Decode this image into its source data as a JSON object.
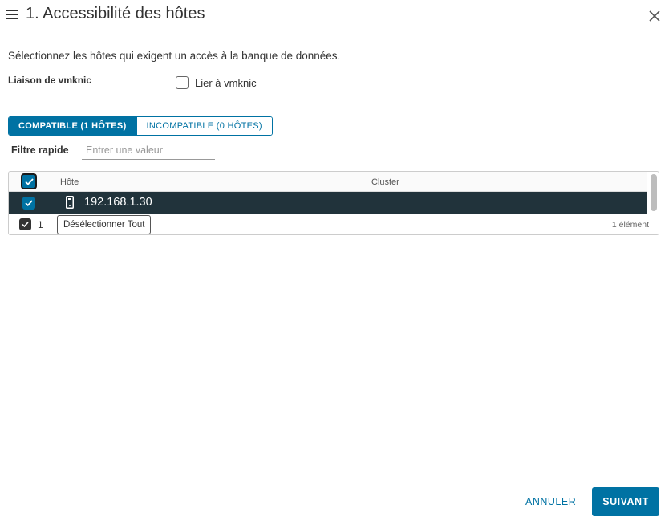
{
  "dialog": {
    "title": "1. Accessibilité des hôtes",
    "description": "Sélectionnez les hôtes qui exigent un accès à la banque de données."
  },
  "vmknic": {
    "label": "Liaison de vmknic",
    "checkbox_label": "Lier à vmknic",
    "checked": false
  },
  "tabs": [
    {
      "label": "COMPATIBLE (1 HÔTES)",
      "active": true
    },
    {
      "label": "INCOMPATIBLE (0 HÔTES)",
      "active": false
    }
  ],
  "filter": {
    "label": "Filtre rapide",
    "placeholder": "Entrer une valeur"
  },
  "grid": {
    "columns": [
      "Hôte",
      "Cluster"
    ],
    "rows": [
      {
        "host": "192.168.1.30",
        "cluster": "",
        "selected": true
      }
    ],
    "footer": {
      "selected_count": "1",
      "deselect_all_label": "Désélectionner Tout",
      "item_count": "1 élément"
    }
  },
  "actions": {
    "cancel": "ANNULER",
    "next": "SUIVANT"
  },
  "colors": {
    "accent": "#0072a3",
    "selected_row": "#21333b"
  },
  "icons": {
    "menu": "hamburger-icon",
    "close": "close-icon",
    "host": "host-server-icon",
    "check": "checkmark-icon"
  }
}
